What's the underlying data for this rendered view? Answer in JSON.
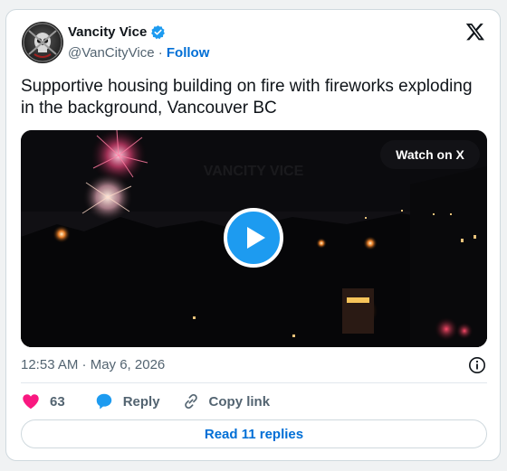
{
  "author": {
    "display_name": "Vancity Vice",
    "handle": "@VanCityVice",
    "separator": "·",
    "follow_label": "Follow",
    "avatar_lettering": "VANCITY VICE",
    "verified_color": "#1d9bf0"
  },
  "tweet": {
    "text": "Supportive housing building on fire with fireworks exploding in the background, Vancouver BC",
    "timestamp": "12:53 AM · May 6, 2026"
  },
  "media": {
    "watch_label": "Watch on X",
    "play_icon": "play-icon",
    "watermark_text": "VANCITY VICE"
  },
  "actions": {
    "like_count": "63",
    "reply_label": "Reply",
    "copy_label": "Copy link",
    "like_color": "#f91880",
    "reply_color": "#1d9bf0"
  },
  "footer": {
    "read_replies_label": "Read 11 replies"
  },
  "colors": {
    "accent": "#006fd6",
    "muted": "#536471",
    "border": "#cfd9de"
  }
}
